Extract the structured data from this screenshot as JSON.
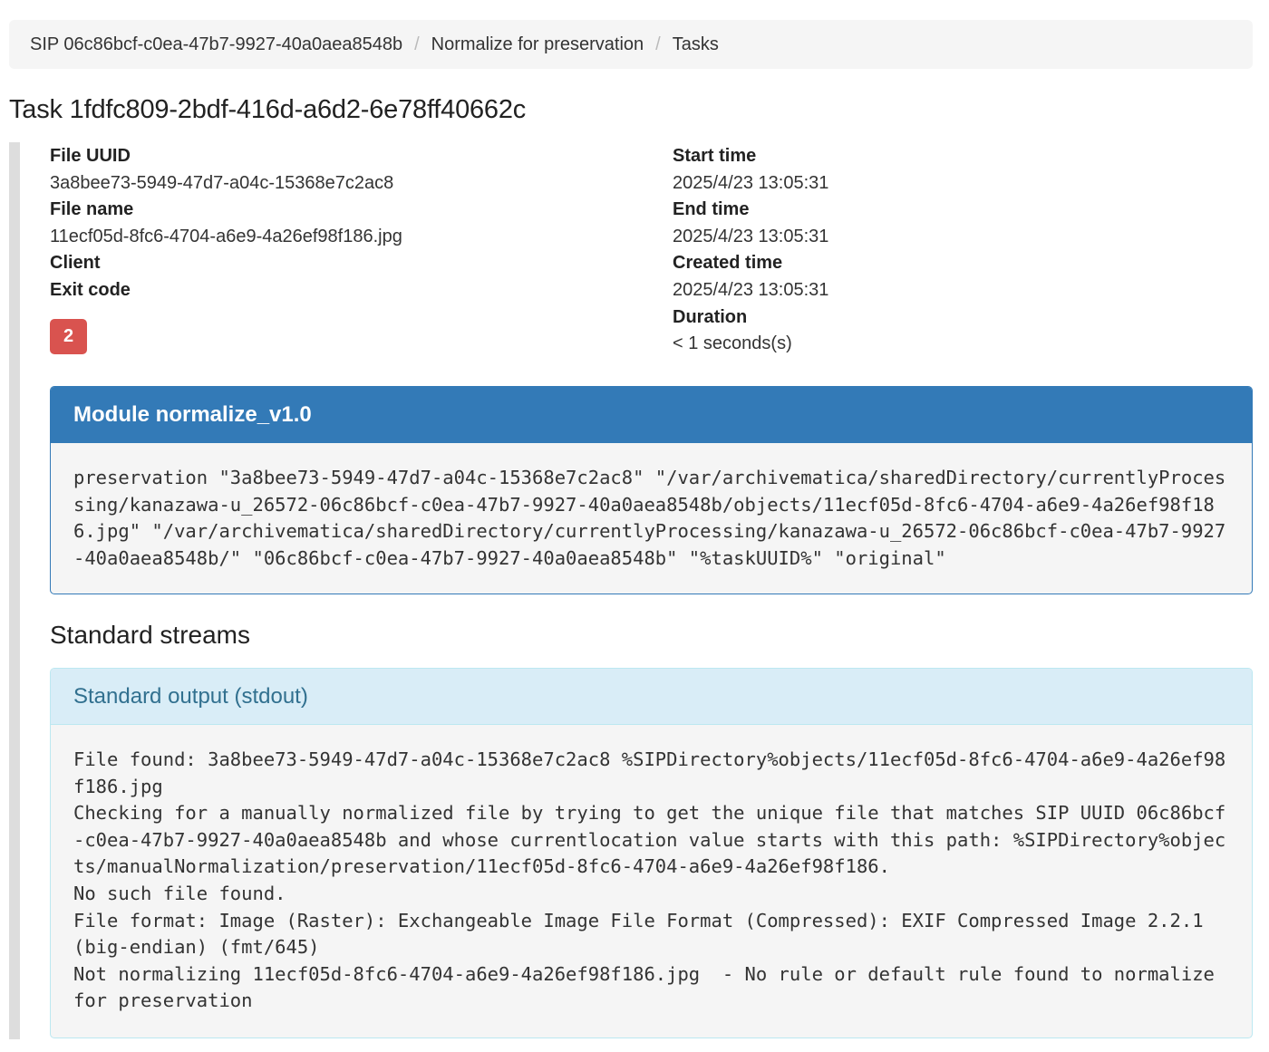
{
  "breadcrumb": {
    "items": [
      "SIP 06c86bcf-c0ea-47b7-9927-40a0aea8548b",
      "Normalize for preservation",
      "Tasks"
    ],
    "separator": "/"
  },
  "task": {
    "title": "Task 1fdfc809-2bdf-416d-a6d2-6e78ff40662c"
  },
  "details": {
    "file_uuid_label": "File UUID",
    "file_uuid": "3a8bee73-5949-47d7-a04c-15368e7c2ac8",
    "file_name_label": "File name",
    "file_name": "11ecf05d-8fc6-4704-a6e9-4a26ef98f186.jpg",
    "client_label": "Client",
    "exit_code_label": "Exit code",
    "exit_code": "2",
    "start_time_label": "Start time",
    "start_time": "2025/4/23 13:05:31",
    "end_time_label": "End time",
    "end_time": "2025/4/23 13:05:31",
    "created_time_label": "Created time",
    "created_time": "2025/4/23 13:05:31",
    "duration_label": "Duration",
    "duration": "< 1 seconds(s)"
  },
  "module": {
    "heading": "Module normalize_v1.0",
    "command": "preservation \"3a8bee73-5949-47d7-a04c-15368e7c2ac8\" \"/var/archivematica/sharedDirectory/currentlyProcessing/kanazawa-u_26572-06c86bcf-c0ea-47b7-9927-40a0aea8548b/objects/11ecf05d-8fc6-4704-a6e9-4a26ef98f186.jpg\" \"/var/archivematica/sharedDirectory/currentlyProcessing/kanazawa-u_26572-06c86bcf-c0ea-47b7-9927-40a0aea8548b/\" \"06c86bcf-c0ea-47b7-9927-40a0aea8548b\" \"%taskUUID%\" \"original\""
  },
  "streams": {
    "heading": "Standard streams",
    "stdout_heading": "Standard output (stdout)",
    "stdout": "File found: 3a8bee73-5949-47d7-a04c-15368e7c2ac8 %SIPDirectory%objects/11ecf05d-8fc6-4704-a6e9-4a26ef98f186.jpg\nChecking for a manually normalized file by trying to get the unique file that matches SIP UUID 06c86bcf-c0ea-47b7-9927-40a0aea8548b and whose currentlocation value starts with this path: %SIPDirectory%objects/manualNormalization/preservation/11ecf05d-8fc6-4704-a6e9-4a26ef98f186.\nNo such file found.\nFile format: Image (Raster): Exchangeable Image File Format (Compressed): EXIF Compressed Image 2.2.1 (big-endian) (fmt/645)\nNot normalizing 11ecf05d-8fc6-4704-a6e9-4a26ef98f186.jpg  - No rule or default rule found to normalize for preservation"
  },
  "colors": {
    "primary": "#337ab7",
    "info_bg": "#d9edf7",
    "info_text": "#31708f",
    "danger": "#d9534f"
  }
}
